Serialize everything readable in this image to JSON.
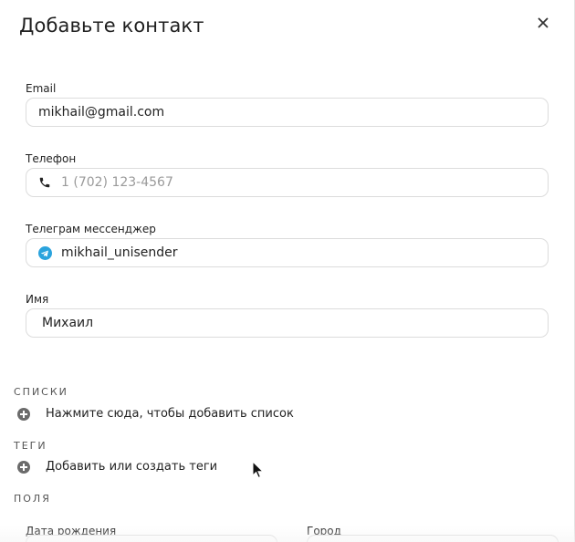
{
  "dialog": {
    "title": "Добавьте контакт"
  },
  "fields": {
    "email": {
      "label": "Email",
      "value": "mikhail@gmail.com"
    },
    "phone": {
      "label": "Телефон",
      "placeholder": "1 (702) 123-4567"
    },
    "telegram": {
      "label": "Телеграм мессенджер",
      "value": "mikhail_unisender"
    },
    "name": {
      "label": "Имя",
      "value": "Михаил"
    }
  },
  "lists": {
    "heading": "СПИСКИ",
    "add_label": "Нажмите сюда, чтобы добавить список"
  },
  "tags": {
    "heading": "ТЕГИ",
    "add_label": "Добавить или создать теги"
  },
  "custom_fields": {
    "heading": "ПОЛЯ",
    "birthdate_label": "Дата рождения",
    "city_label": "Город"
  },
  "colors": {
    "telegram_blue": "#2aa3dd",
    "border": "#dcdcdc"
  }
}
